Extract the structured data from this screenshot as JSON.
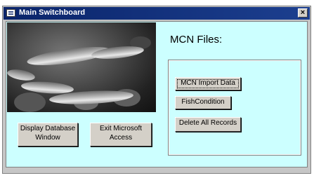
{
  "window": {
    "title": "Main Switchboard",
    "close_glyph": "×"
  },
  "main": {
    "heading": "MCN Files:",
    "buttons": {
      "import_label": "MCN Import Data",
      "fish_label": "FishCondition",
      "delete_label": "Delete All Records",
      "display_label": "Display Database Window",
      "exit_label": "Exit Microsoft Access"
    }
  },
  "icons": {
    "window_icon": "form-icon",
    "close": "close-icon"
  },
  "colors": {
    "titlebar": "#0a246a",
    "client_background": "#ccffff",
    "button_face": "#d4d0c8"
  }
}
